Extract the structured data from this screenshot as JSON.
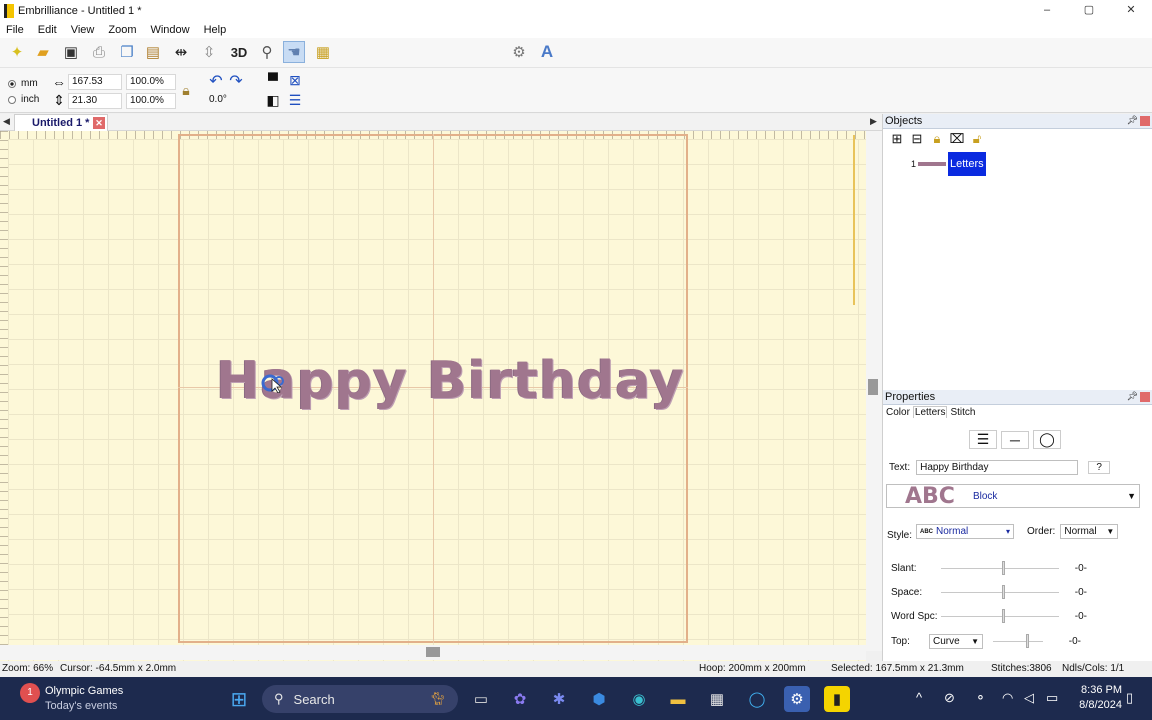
{
  "window": {
    "title": "Embrilliance -  Untitled 1 *",
    "controls": [
      "–",
      "▢",
      "✕"
    ]
  },
  "menu": [
    "File",
    "Edit",
    "View",
    "Zoom",
    "Window",
    "Help"
  ],
  "toolbar": {
    "three_d_label": "3D",
    "text_tool_label": "A"
  },
  "dimensions": {
    "unit_mm": "mm",
    "unit_inch": "inch",
    "width": "167.53",
    "height": "21.30",
    "width_pct": "100.0%",
    "height_pct": "100.0%",
    "rotation": "0.0°"
  },
  "doc_tab": {
    "label": "Untitled 1 *"
  },
  "canvas": {
    "embroidery_text": "Happy Birthday",
    "embroidery_color": "#a0768e"
  },
  "objects_panel": {
    "title": "Objects",
    "items": [
      {
        "number": "1",
        "label": "Letters"
      }
    ]
  },
  "properties_panel": {
    "title": "Properties",
    "tabs": [
      "Color",
      "Letters",
      "Stitch"
    ],
    "active_tab": "Letters",
    "text_label": "Text:",
    "text_value": "Happy Birthday",
    "help_label": "?",
    "font_preview": "ABC",
    "font_name": "Block",
    "style_label": "Style:",
    "style_value": "Normal",
    "style_prefix": "ABC",
    "order_label": "Order:",
    "order_value": "Normal",
    "slant_label": "Slant:",
    "slant_value": "-0-",
    "space_label": "Space:",
    "space_value": "-0-",
    "word_spc_label": "Word Spc:",
    "word_spc_value": "-0-",
    "top_label": "Top:",
    "top_select": "Curve",
    "top_value": "-0-"
  },
  "statusbar": {
    "zoom": "Zoom: 66%",
    "cursor": "Cursor: -64.5mm x 2.0mm",
    "hoop": "Hoop: 200mm x 200mm",
    "selected": "Selected: 167.5mm x 21.3mm",
    "stitches": "Stitches:3806",
    "ndls": "Ndls/Cols: 1/1"
  },
  "taskbar": {
    "news_title": "Olympic Games",
    "news_subtitle": "Today's events",
    "news_badge": "1",
    "search_placeholder": "Search",
    "time": "8:36 PM",
    "date": "8/8/2024"
  }
}
